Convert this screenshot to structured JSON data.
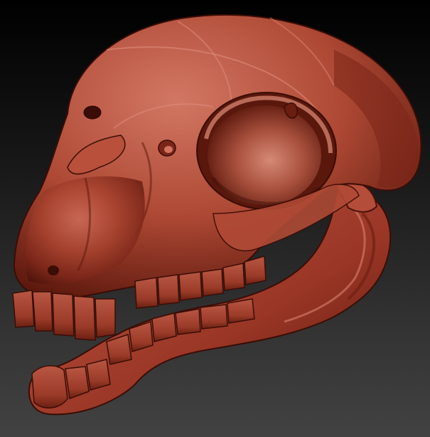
{
  "scene": {
    "subject": "skull-sculpt",
    "colors": {
      "background_top": "#000000",
      "background_bottom": "#434343",
      "clay_base": "#9c3a2a",
      "clay_light": "#d77a68",
      "clay_mid": "#b8503c",
      "clay_shadow": "#4a120b",
      "clay_deep": "#2a0805"
    }
  }
}
